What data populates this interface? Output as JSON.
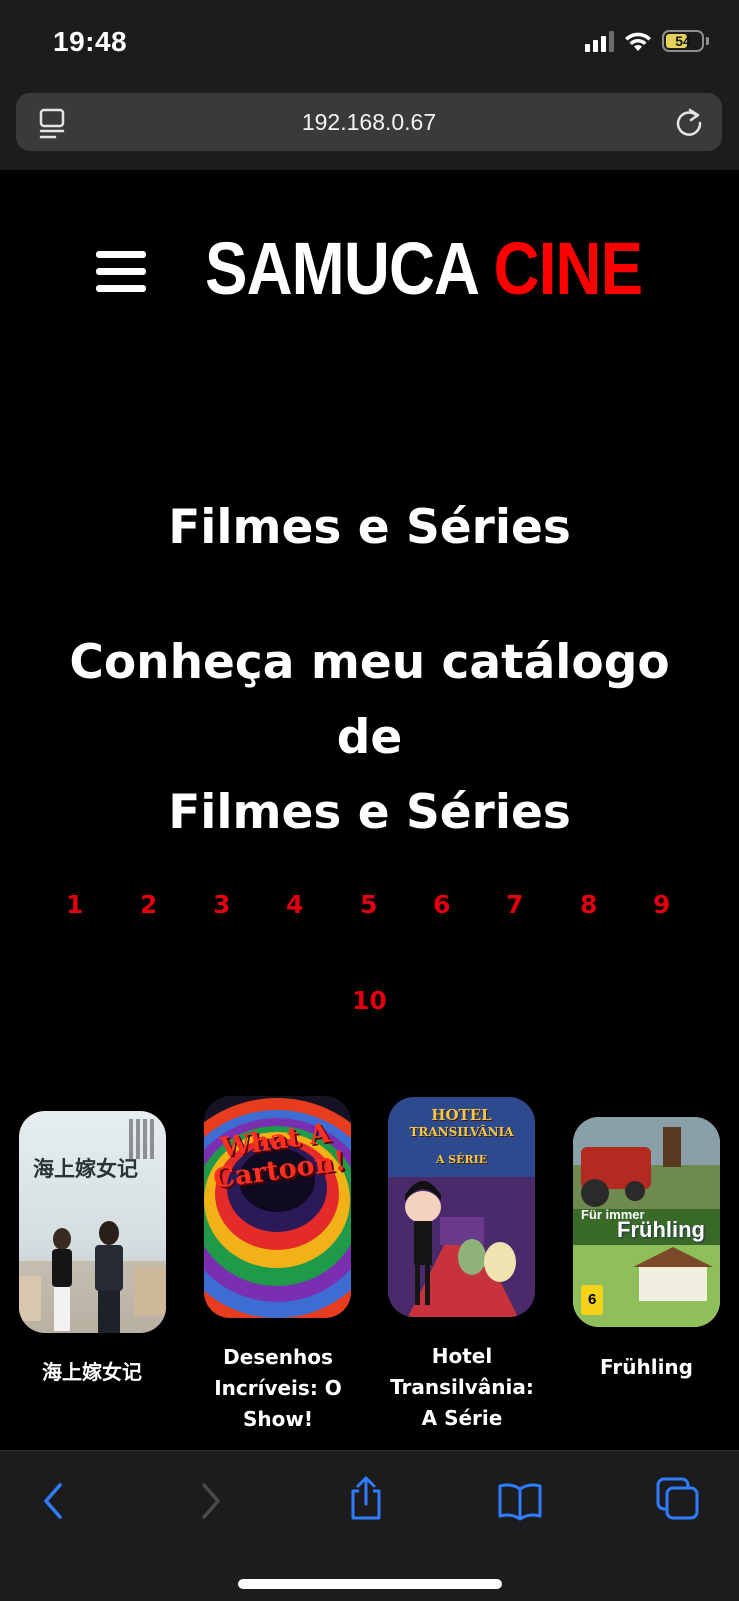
{
  "status": {
    "time": "19:48",
    "battery": "54"
  },
  "browser": {
    "url": "192.168.0.67"
  },
  "header": {
    "logo_white": "SAMUCA",
    "logo_red": "CINE"
  },
  "hero": {
    "title": "Filmes e Séries",
    "subtitle_line1": "Conheça meu catálogo de",
    "subtitle_line2": "Filmes e Séries"
  },
  "pagination": [
    "1",
    "2",
    "3",
    "4",
    "5",
    "6",
    "7",
    "8",
    "9",
    "10"
  ],
  "catalog": [
    {
      "title": "海上嫁女记",
      "poster_text": "海上嫁女记"
    },
    {
      "title_line1": "Desenhos",
      "title_line2": "Incríveis: O Show!",
      "poster_text_1": "What A",
      "poster_text_2": "Cartoon!"
    },
    {
      "title_line1": "Hotel Transilvânia:",
      "title_line2": "A Série",
      "poster_text_1": "HOTEL",
      "poster_text_2": "TRANSILVÂNIA",
      "poster_text_3": "A SÉRIE"
    },
    {
      "title": "Frühling",
      "poster_text_1": "Für immer",
      "poster_text_2": "Frühling",
      "poster_rating": "6"
    }
  ],
  "colors": {
    "accent": "#ff0000",
    "page_link": "#e00010",
    "toolbar_icon": "#2f7dff"
  }
}
